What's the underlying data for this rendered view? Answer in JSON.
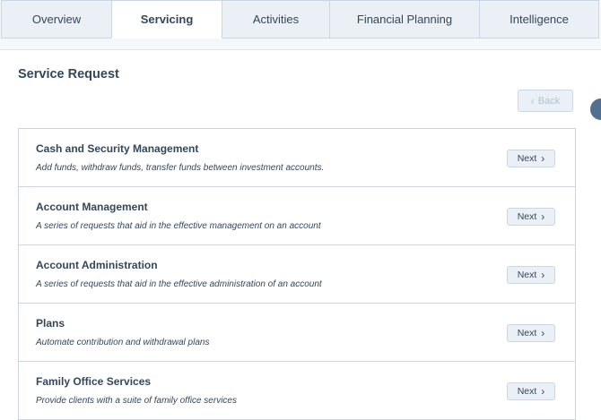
{
  "tabs": [
    {
      "label": "Overview"
    },
    {
      "label": "Servicing"
    },
    {
      "label": "Activities"
    },
    {
      "label": "Financial Planning"
    },
    {
      "label": "Intelligence"
    }
  ],
  "active_tab": "Servicing",
  "page": {
    "title": "Service Request",
    "back_label": "Back"
  },
  "requests": [
    {
      "title": "Cash and Security Management",
      "description": "Add funds, withdraw funds, transfer funds between investment accounts.",
      "next_label": "Next"
    },
    {
      "title": "Account Management",
      "description": "A series of requests that aid in the effective management on an account",
      "next_label": "Next"
    },
    {
      "title": "Account Administration",
      "description": "A series of requests that aid in the effective administration of an account",
      "next_label": "Next"
    },
    {
      "title": "Plans",
      "description": "Automate contribution and withdrawal plans",
      "next_label": "Next"
    },
    {
      "title": "Family Office Services",
      "description": "Provide clients with a suite of family office services",
      "next_label": "Next"
    }
  ],
  "icons": {
    "back": "chevron-left-icon",
    "next": "chevron-right-icon"
  },
  "colors": {
    "text": "#33475b",
    "border": "#cbd6e2",
    "button_bg": "#eaf0f6",
    "disabled_text": "#b0c1d4"
  }
}
